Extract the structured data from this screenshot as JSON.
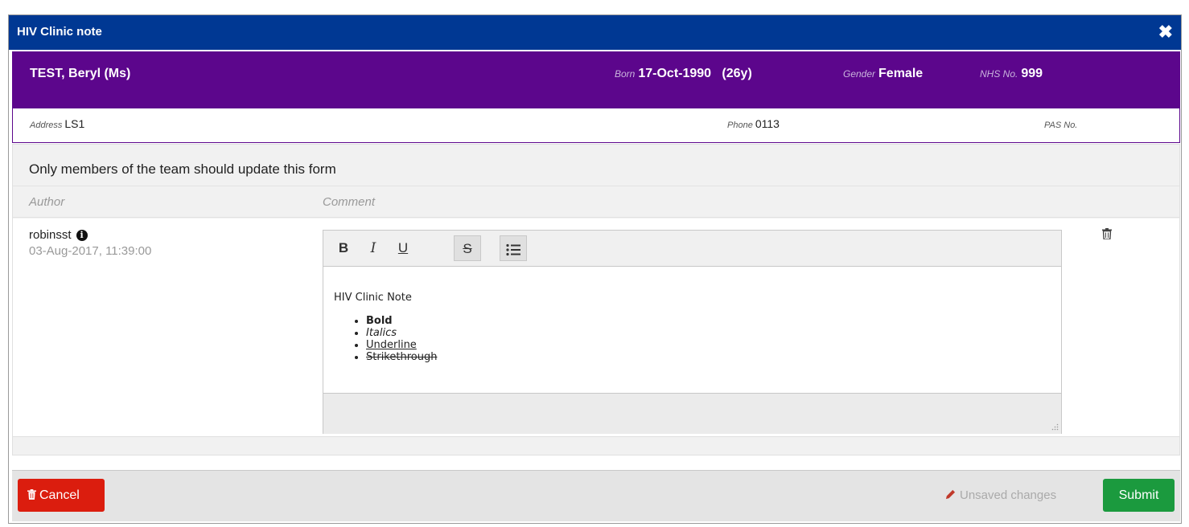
{
  "dialog": {
    "title": "HIV Clinic note",
    "close_icon": "close-icon",
    "title_bar_color": "#003893"
  },
  "patient": {
    "banner_color": "#5c068c",
    "name": "TEST, Beryl (Ms)",
    "born_label": "Born",
    "born_value": "17-Oct-1990   (26y)",
    "gender_label": "Gender",
    "gender_value": "Female",
    "nhs_label": "NHS No.",
    "nhs_value": "999",
    "address_label": "Address",
    "address_value": "LS1",
    "phone_label": "Phone",
    "phone_value": "0113",
    "pas_label": "PAS No.",
    "pas_value": ""
  },
  "form": {
    "heading": "Only members of the team should update this form",
    "col_author": "Author",
    "col_comment": "Comment",
    "entry": {
      "author": "robinsst",
      "info_icon": "info-icon",
      "date": "03-Aug-2017, 11:39:00",
      "delete_icon": "trash-icon"
    }
  },
  "editor": {
    "toolbar": {
      "bold": "B",
      "italic": "I",
      "underline": "U",
      "strikethrough": "S",
      "list_icon": "list-icon"
    },
    "content": {
      "title": "HIV Clinic Note",
      "items": [
        "Bold",
        "Italics",
        "Underline",
        "Strikethrough"
      ]
    },
    "resize_icon": "resize-grip-icon"
  },
  "footer": {
    "cancel_label": "Cancel",
    "cancel_icon": "trash-icon",
    "unsaved_label": "Unsaved changes",
    "unsaved_icon": "pencil-icon",
    "submit_label": "Submit",
    "cancel_color": "#db1d0e",
    "submit_color": "#1b9a3e"
  }
}
